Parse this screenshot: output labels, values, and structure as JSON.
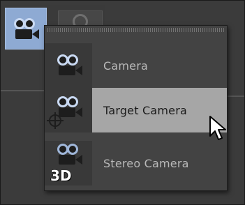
{
  "menu": {
    "items": [
      {
        "label": "Camera",
        "icon": "camera-icon",
        "state": "normal"
      },
      {
        "label": "Target Camera",
        "icon": "target-camera-icon",
        "state": "hover"
      },
      {
        "label": "Stereo Camera",
        "icon": "stereo-camera-icon",
        "state": "normal",
        "badge": "3D"
      }
    ]
  },
  "toolbar": {
    "active_icon": "camera-icon",
    "second_icon": "circle-icon"
  },
  "colors": {
    "highlight": "#a6a6a6",
    "active_button": "#8eaad3",
    "menu_bg": "#434343",
    "text": "#b9b9b9"
  }
}
